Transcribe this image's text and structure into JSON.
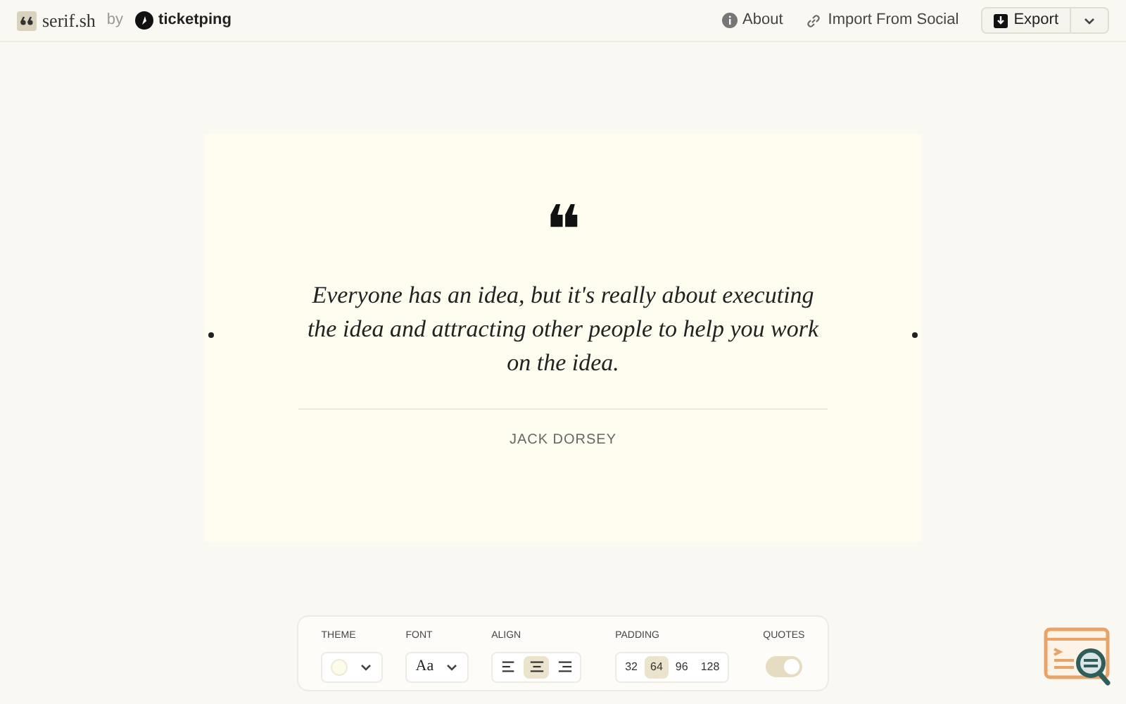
{
  "header": {
    "brand": "serif.sh",
    "by": "by",
    "partner": "ticketping",
    "links": [
      {
        "label": "About",
        "kind": "info"
      },
      {
        "label": "Import From Social",
        "kind": "link"
      }
    ],
    "export": "Export"
  },
  "card": {
    "quote_mark": "❝",
    "quote": "Everyone has an idea, but it's really about executing the idea and attracting other people to help you work on the idea.",
    "author": "JACK DORSEY"
  },
  "toolbar": {
    "theme": {
      "label": "THEME",
      "color": "#fdfbe9"
    },
    "font": {
      "label": "FONT",
      "value": "Aa"
    },
    "align": {
      "label": "ALIGN",
      "options": [
        {
          "kind": "left",
          "selected": false
        },
        {
          "kind": "center",
          "selected": true
        },
        {
          "kind": "right",
          "selected": false
        }
      ]
    },
    "padding": {
      "label": "PADDING",
      "options": [
        {
          "label": "32",
          "selected": false
        },
        {
          "label": "64",
          "selected": true
        },
        {
          "label": "96",
          "selected": false
        },
        {
          "label": "128",
          "selected": false
        }
      ]
    },
    "quotes": {
      "label": "QUOTES",
      "on": true
    }
  }
}
